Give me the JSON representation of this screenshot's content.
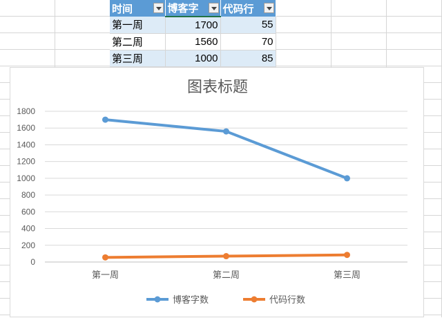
{
  "table": {
    "headers": [
      "时间",
      "博客字",
      "代码行"
    ],
    "rows": [
      [
        "第一周",
        "1700",
        "55"
      ],
      [
        "第二周",
        "1560",
        "70"
      ],
      [
        "第三周",
        "1000",
        "85"
      ]
    ]
  },
  "chart_data": {
    "type": "line",
    "title": "图表标题",
    "categories": [
      "第一周",
      "第二周",
      "第三周"
    ],
    "series": [
      {
        "name": "博客字数",
        "values": [
          1700,
          1560,
          1000
        ],
        "color": "#5b9bd5"
      },
      {
        "name": "代码行数",
        "values": [
          55,
          70,
          85
        ],
        "color": "#ed7d31"
      }
    ],
    "ylim": [
      0,
      1800
    ],
    "yticks": [
      "0",
      "200",
      "400",
      "600",
      "800",
      "1000",
      "1200",
      "1400",
      "1600",
      "1800"
    ],
    "grid": true,
    "legend": "bottom"
  }
}
